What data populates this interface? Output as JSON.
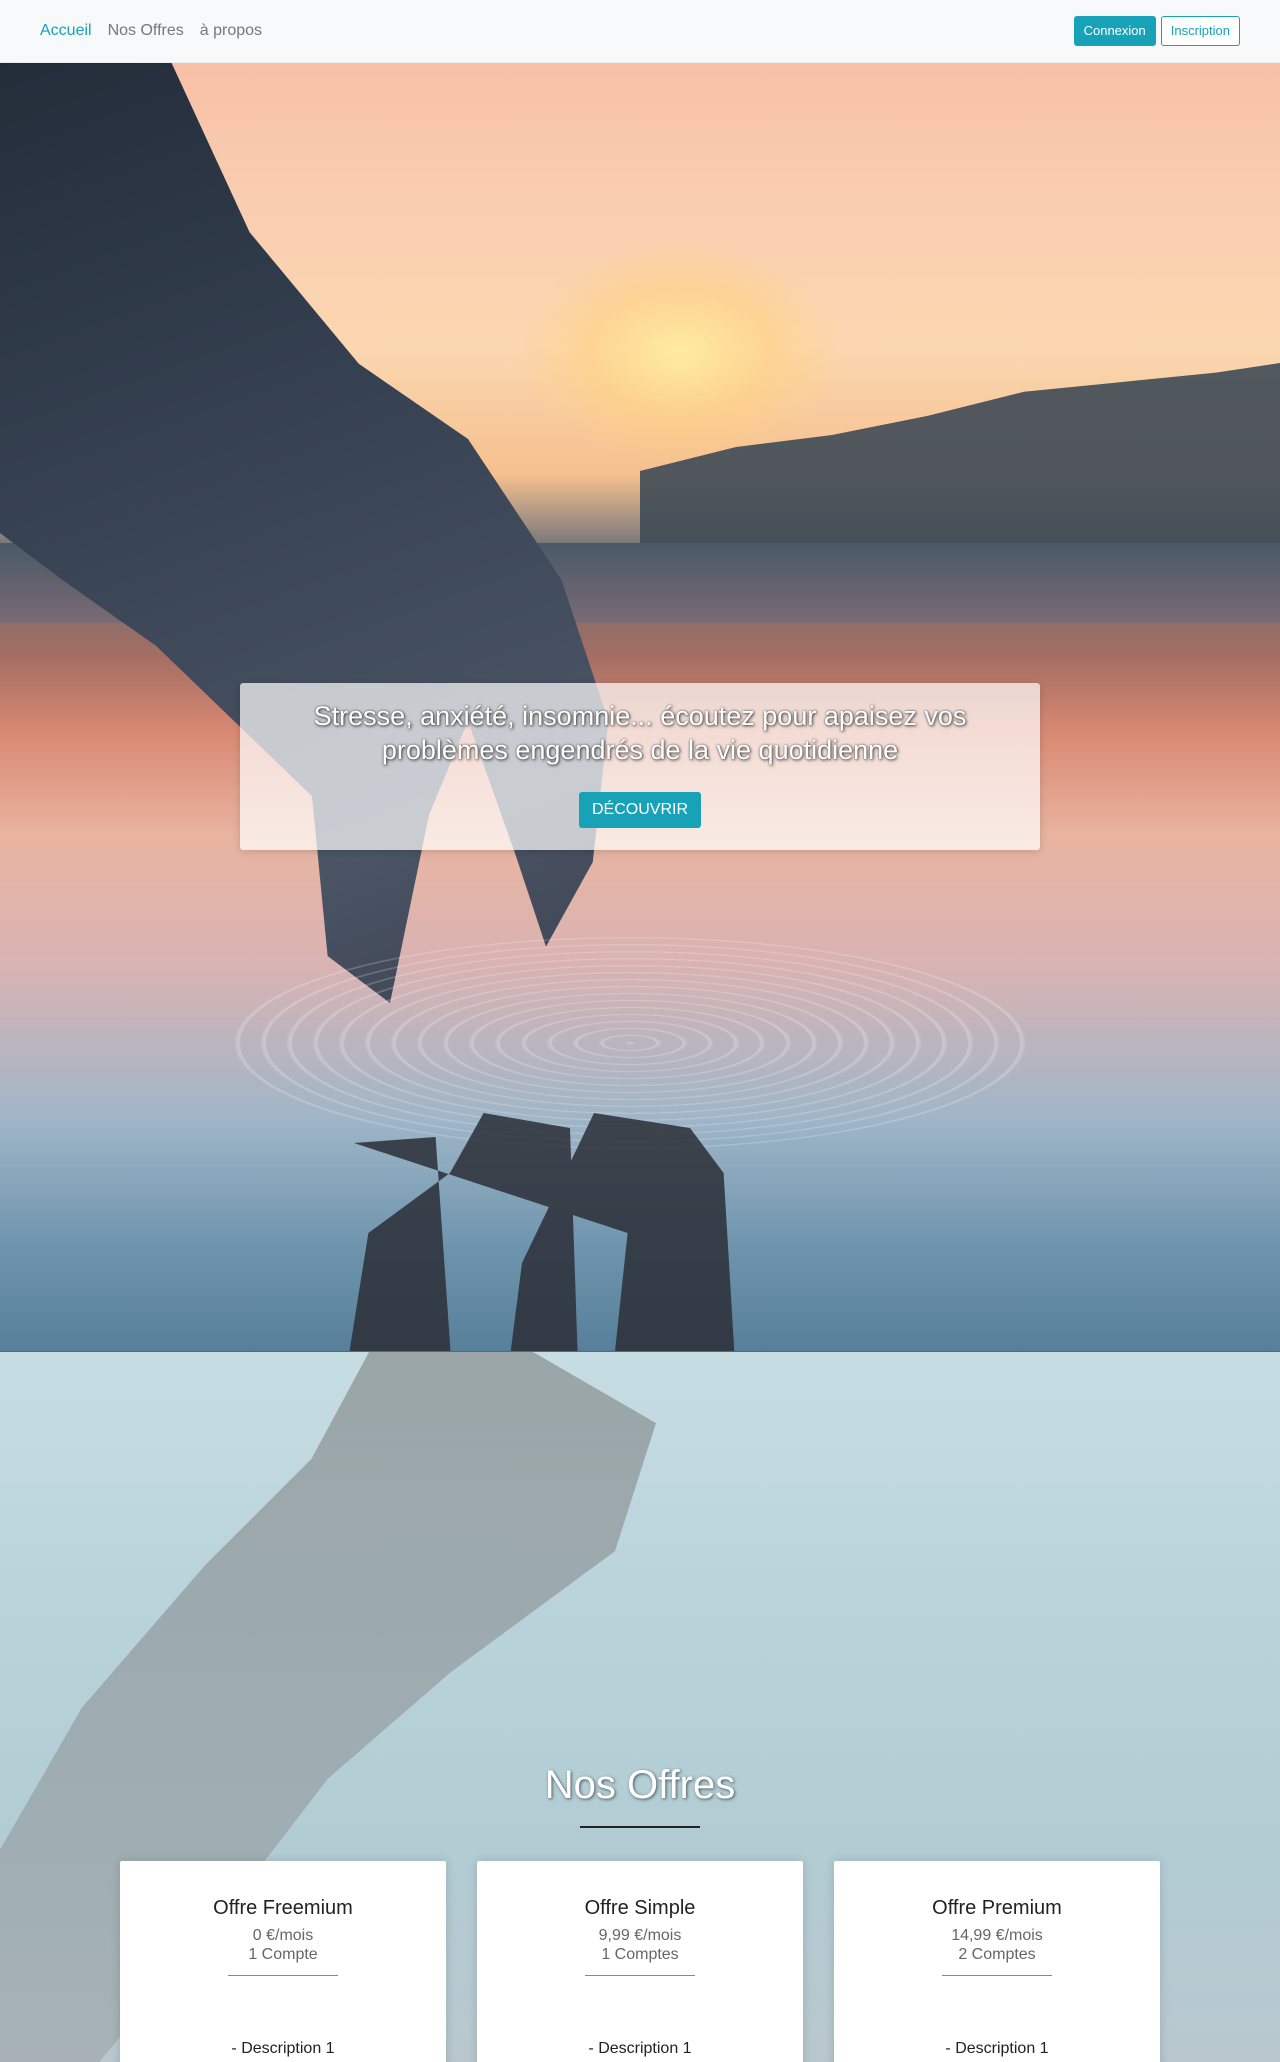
{
  "nav": {
    "links": [
      "Accueil",
      "Nos Offres",
      "à propos"
    ],
    "login_label": "Connexion",
    "signup_label": "Inscription"
  },
  "hero": {
    "title": "Stresse, anxiété, insomnie... écoutez pour apaisez vos problèmes engendrés de la vie quotidienne",
    "cta_label": "DÉCOUVRIR"
  },
  "offers": {
    "section_title": "Nos Offres",
    "cards": [
      {
        "title": "Offre Freemium",
        "price": "0 €/mois",
        "accounts": "1 Compte",
        "description": "- Description 1"
      },
      {
        "title": "Offre Simple",
        "price": "9,99 €/mois",
        "accounts": "1 Comptes",
        "description": "- Description 1"
      },
      {
        "title": "Offre Premium",
        "price": "14,99 €/mois",
        "accounts": "2 Comptes",
        "description": "- Description 1"
      }
    ]
  },
  "colors": {
    "accent": "#17a2b8",
    "navbar_bg": "#f8f9fa",
    "nav_link": "#777777"
  }
}
